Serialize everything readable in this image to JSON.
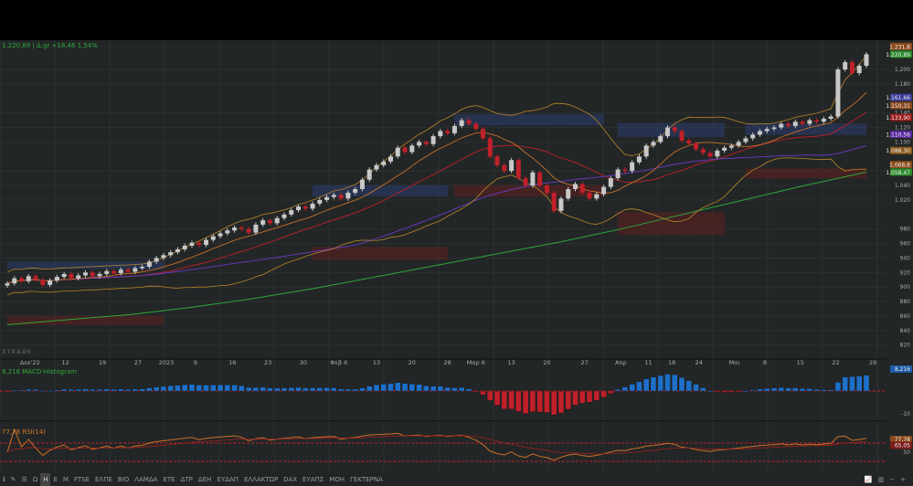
{
  "legend": {
    "text": "1.220,89 | Δ.gr +18,46 1,54%"
  },
  "watermark": "ZTRADE",
  "macd_label": "8,216 MACD-Histogram",
  "rsi_label": "77,78 RSI(14)",
  "toolbar": {
    "items": [
      "Ω",
      "H",
      "E",
      "M",
      "FTSE",
      "ΕΛΠΕ",
      "ΒΙΟ",
      "ΛΑΜΔΑ",
      "ΕΤΕ",
      "ΔΤΡ",
      "ΔΕΗ",
      "ΕΥΔΑΠ",
      "ΕΛΛΑΚΤΩΡ",
      "DAX",
      "ΕΥΑΠΣ",
      "ΜΟΗ",
      "ΓΕΚΤΕΡΝΑ"
    ],
    "active": "H"
  },
  "chart_data": {
    "type": "candlestick",
    "title": "",
    "ylim": [
      812,
      1240
    ],
    "closes": [
      905,
      912,
      908,
      915,
      910,
      903,
      909,
      914,
      918,
      912,
      916,
      920,
      915,
      918,
      922,
      919,
      924,
      921,
      926,
      928,
      935,
      940,
      944,
      948,
      952,
      957,
      961,
      958,
      965,
      970,
      974,
      978,
      982,
      980,
      975,
      986,
      992,
      988,
      995,
      1000,
      1006,
      1011,
      1008,
      1015,
      1020,
      1024,
      1027,
      1022,
      1030,
      1035,
      1048,
      1062,
      1068,
      1073,
      1080,
      1092,
      1086,
      1095,
      1100,
      1097,
      1108,
      1115,
      1112,
      1122,
      1130,
      1125,
      1118,
      1105,
      1080,
      1068,
      1060,
      1075,
      1050,
      1040,
      1058,
      1040,
      1030,
      1005,
      1022,
      1035,
      1042,
      1030,
      1022,
      1028,
      1038,
      1050,
      1062,
      1060,
      1072,
      1080,
      1095,
      1100,
      1108,
      1120,
      1115,
      1102,
      1098,
      1090,
      1085,
      1080,
      1088,
      1092,
      1095,
      1100,
      1105,
      1110,
      1115,
      1118,
      1120,
      1125,
      1122,
      1128,
      1125,
      1130,
      1128,
      1132,
      1135,
      1200,
      1210,
      1195,
      1205,
      1220.89
    ],
    "sma200": [
      848,
      855,
      862,
      872,
      884,
      898,
      914,
      930,
      946,
      962,
      980,
      1000,
      1020,
      1040,
      1058.47
    ],
    "xticks": [
      {
        "label": "Δεκ'22",
        "idx": 3.2
      },
      {
        "label": "12",
        "idx": 8.2
      },
      {
        "label": "19",
        "idx": 13.4
      },
      {
        "label": "27",
        "idx": 18.4
      },
      {
        "label": "2023",
        "idx": 22.4
      },
      {
        "label": "9",
        "idx": 26.5
      },
      {
        "label": "16",
        "idx": 31.7
      },
      {
        "label": "23",
        "idx": 36.7
      },
      {
        "label": "30",
        "idx": 41.7
      },
      {
        "label": "Φεβ 6",
        "idx": 46.7
      },
      {
        "label": "13",
        "idx": 52
      },
      {
        "label": "20",
        "idx": 57
      },
      {
        "label": "28",
        "idx": 62
      },
      {
        "label": "Μαρ 6",
        "idx": 66
      },
      {
        "label": "13",
        "idx": 71
      },
      {
        "label": "20",
        "idx": 76
      },
      {
        "label": "27",
        "idx": 81.3
      },
      {
        "label": "Απρ",
        "idx": 86.4
      },
      {
        "label": "11",
        "idx": 90.3
      },
      {
        "label": "18",
        "idx": 93.6
      },
      {
        "label": "24",
        "idx": 97.4
      },
      {
        "label": "Μαι",
        "idx": 102.4
      },
      {
        "label": "8",
        "idx": 106.7
      },
      {
        "label": "15",
        "idx": 111.7
      },
      {
        "label": "22",
        "idx": 116.7
      },
      {
        "label": "29",
        "idx": 121.9
      }
    ],
    "yticks": [
      "1.200",
      "1.180",
      "1.140",
      "1.120",
      "1.100",
      "1.060",
      "1.040",
      "1.020",
      "980",
      "960",
      "940",
      "920",
      "900",
      "880",
      "860",
      "840",
      "820"
    ],
    "ytick_values": [
      1200,
      1180,
      1140,
      1120,
      1100,
      1060,
      1040,
      1020,
      980,
      960,
      940,
      920,
      900,
      880,
      860,
      840,
      820
    ],
    "price_tags": [
      {
        "label": "1.231,8",
        "value": 1231.8,
        "color": "#8a4a1c"
      },
      {
        "label": "1.220,89",
        "value": 1220.89,
        "color": "#2a8a2a"
      },
      {
        "label": "1.161,66",
        "value": 1161.66,
        "color": "#3a3a9a"
      },
      {
        "label": "1.150,31",
        "value": 1150.31,
        "color": "#8a4a1c"
      },
      {
        "label": "1.133,90",
        "value": 1133.9,
        "color": "#9a1a1a"
      },
      {
        "label": "1.110,56",
        "value": 1110.56,
        "color": "#5a2aa0"
      },
      {
        "label": "1.088,30",
        "value": 1088.3,
        "color": "#8a5a1c"
      },
      {
        "label": "1.068,8",
        "value": 1068.8,
        "color": "#8a4a1c"
      },
      {
        "label": "1.058,47",
        "value": 1058.47,
        "color": "#2a8a2a"
      }
    ],
    "zones": [
      {
        "from": 0,
        "to": 22,
        "low": 925,
        "high": 935,
        "color": "#2a3a6a"
      },
      {
        "from": 0,
        "to": 22,
        "low": 848,
        "high": 860,
        "color": "#5a2020"
      },
      {
        "from": 43,
        "to": 62,
        "low": 1025,
        "high": 1040,
        "color": "#2a3a6a"
      },
      {
        "from": 43,
        "to": 62,
        "low": 938,
        "high": 955,
        "color": "#5a2020"
      },
      {
        "from": 63,
        "to": 84,
        "low": 1123,
        "high": 1138,
        "color": "#2a3a6a"
      },
      {
        "from": 63,
        "to": 84,
        "low": 1025,
        "high": 1040,
        "color": "#5a2020"
      },
      {
        "from": 86,
        "to": 101,
        "low": 1107,
        "high": 1126,
        "color": "#2a3a6a"
      },
      {
        "from": 86,
        "to": 101,
        "low": 972,
        "high": 1003,
        "color": "#5a2020"
      },
      {
        "from": 104,
        "to": 121,
        "low": 1110,
        "high": 1125,
        "color": "#2a3a6a"
      },
      {
        "from": 104,
        "to": 121,
        "low": 1050,
        "high": 1063,
        "color": "#5a2020"
      }
    ],
    "macd": {
      "label": "8,216",
      "tick": "-10",
      "value": 8.216
    },
    "rsi": {
      "label": "77,78",
      "label2": "65,05",
      "tick": "50",
      "value": 77.78,
      "levels": [
        70,
        30
      ]
    },
    "colors": {
      "up": "#c8c8c8",
      "down": "#c0202a",
      "macd_up": "#1e6fc8",
      "macd_down": "#c0202a",
      "sma200": "#2ea83a",
      "rsi": "#c8702a"
    }
  }
}
